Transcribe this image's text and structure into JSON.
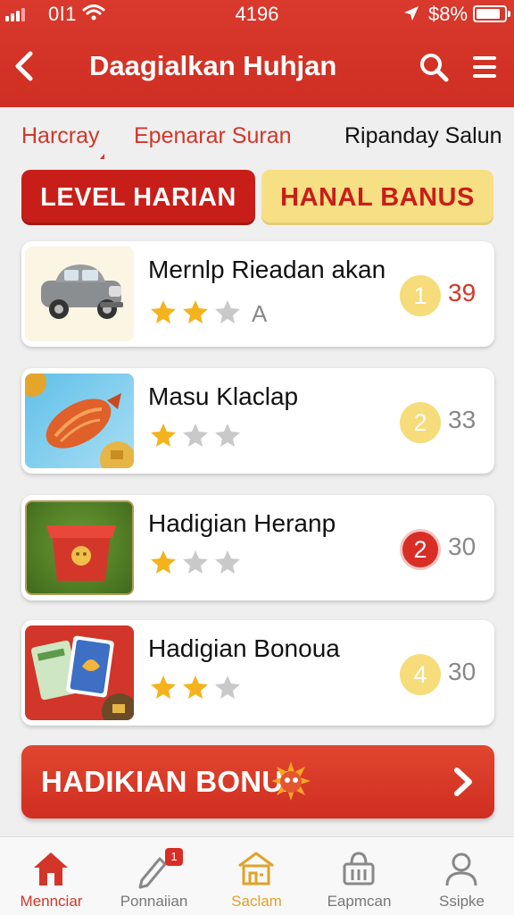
{
  "status_bar": {
    "carrier": "0l1",
    "time": "4196",
    "battery": "$8%"
  },
  "header": {
    "title": "Daagialkan Huhjan",
    "back_icon": "chevron-left-icon",
    "search_icon": "search-icon",
    "menu_icon": "menu-icon"
  },
  "subtabs": [
    {
      "label": "Harcray"
    },
    {
      "label": "Epenarar Suran"
    },
    {
      "label": "Ripanday Salun"
    }
  ],
  "segments": {
    "left": "LEVEL HARIAN",
    "right": "HANAL BANUS"
  },
  "cards": [
    {
      "title": "Mernlp Rieadan akan",
      "stars_filled": 2,
      "stars_total": 3,
      "extra": "A",
      "badge": "1",
      "count": "39",
      "image": "car-thumbnail"
    },
    {
      "title": "Masu Klaclap",
      "stars_filled": 1,
      "stars_total": 3,
      "extra": "",
      "badge": "2",
      "count": "33",
      "image": "roasted-fish-thumbnail"
    },
    {
      "title": "Hadigian Heranp",
      "stars_filled": 1,
      "stars_total": 3,
      "extra": "",
      "badge": "2",
      "count": "30",
      "image": "red-box-thumbnail"
    },
    {
      "title": "Hadigian Bonoua",
      "stars_filled": 2,
      "stars_total": 3,
      "extra": "",
      "badge": "4",
      "count": "30",
      "image": "cards-thumbnail"
    }
  ],
  "bonus": {
    "label": "HADIKIAN BONUX",
    "icon": "fireball-icon"
  },
  "nav": [
    {
      "label": "Mennciar",
      "icon": "home-icon",
      "active": true
    },
    {
      "label": "Ponnaiian",
      "icon": "edit-icon",
      "badge": "1"
    },
    {
      "label": "Saclam",
      "icon": "store-icon"
    },
    {
      "label": "Eapmcan",
      "icon": "basket-icon"
    },
    {
      "label": "Ssipke",
      "icon": "profile-icon"
    }
  ],
  "colors": {
    "primary_red": "#d33629",
    "gold": "#f6dc7a",
    "active_nav": "#d33629",
    "store_nav": "#e0a22a"
  }
}
